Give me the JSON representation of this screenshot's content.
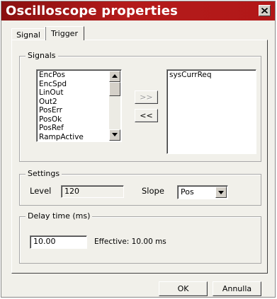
{
  "window": {
    "title": "Oscilloscope properties",
    "close_glyph": "close-icon"
  },
  "tabs": [
    {
      "label": "Signal",
      "active": false
    },
    {
      "label": "Trigger",
      "active": true
    }
  ],
  "signals": {
    "group_label": "Signals",
    "available": [
      "EncPos",
      "EncSpd",
      "LinOut",
      "Out2",
      "PosErr",
      "PosOk",
      "PosRef",
      "RampActive"
    ],
    "selected": [
      "sysCurrReq"
    ],
    "add_label": ">>",
    "remove_label": "<<"
  },
  "settings": {
    "group_label": "Settings",
    "level_label": "Level",
    "level_value": "120",
    "slope_label": "Slope",
    "slope_value": "Pos"
  },
  "delay": {
    "group_label": "Delay time (ms)",
    "value": "10.00",
    "effective": "Effective: 10.00 ms"
  },
  "footer": {
    "ok_label": "OK",
    "cancel_label": "Annulla"
  },
  "colors": {
    "titlebar": "#b21818",
    "dialog_bg": "#f1f0ea"
  }
}
